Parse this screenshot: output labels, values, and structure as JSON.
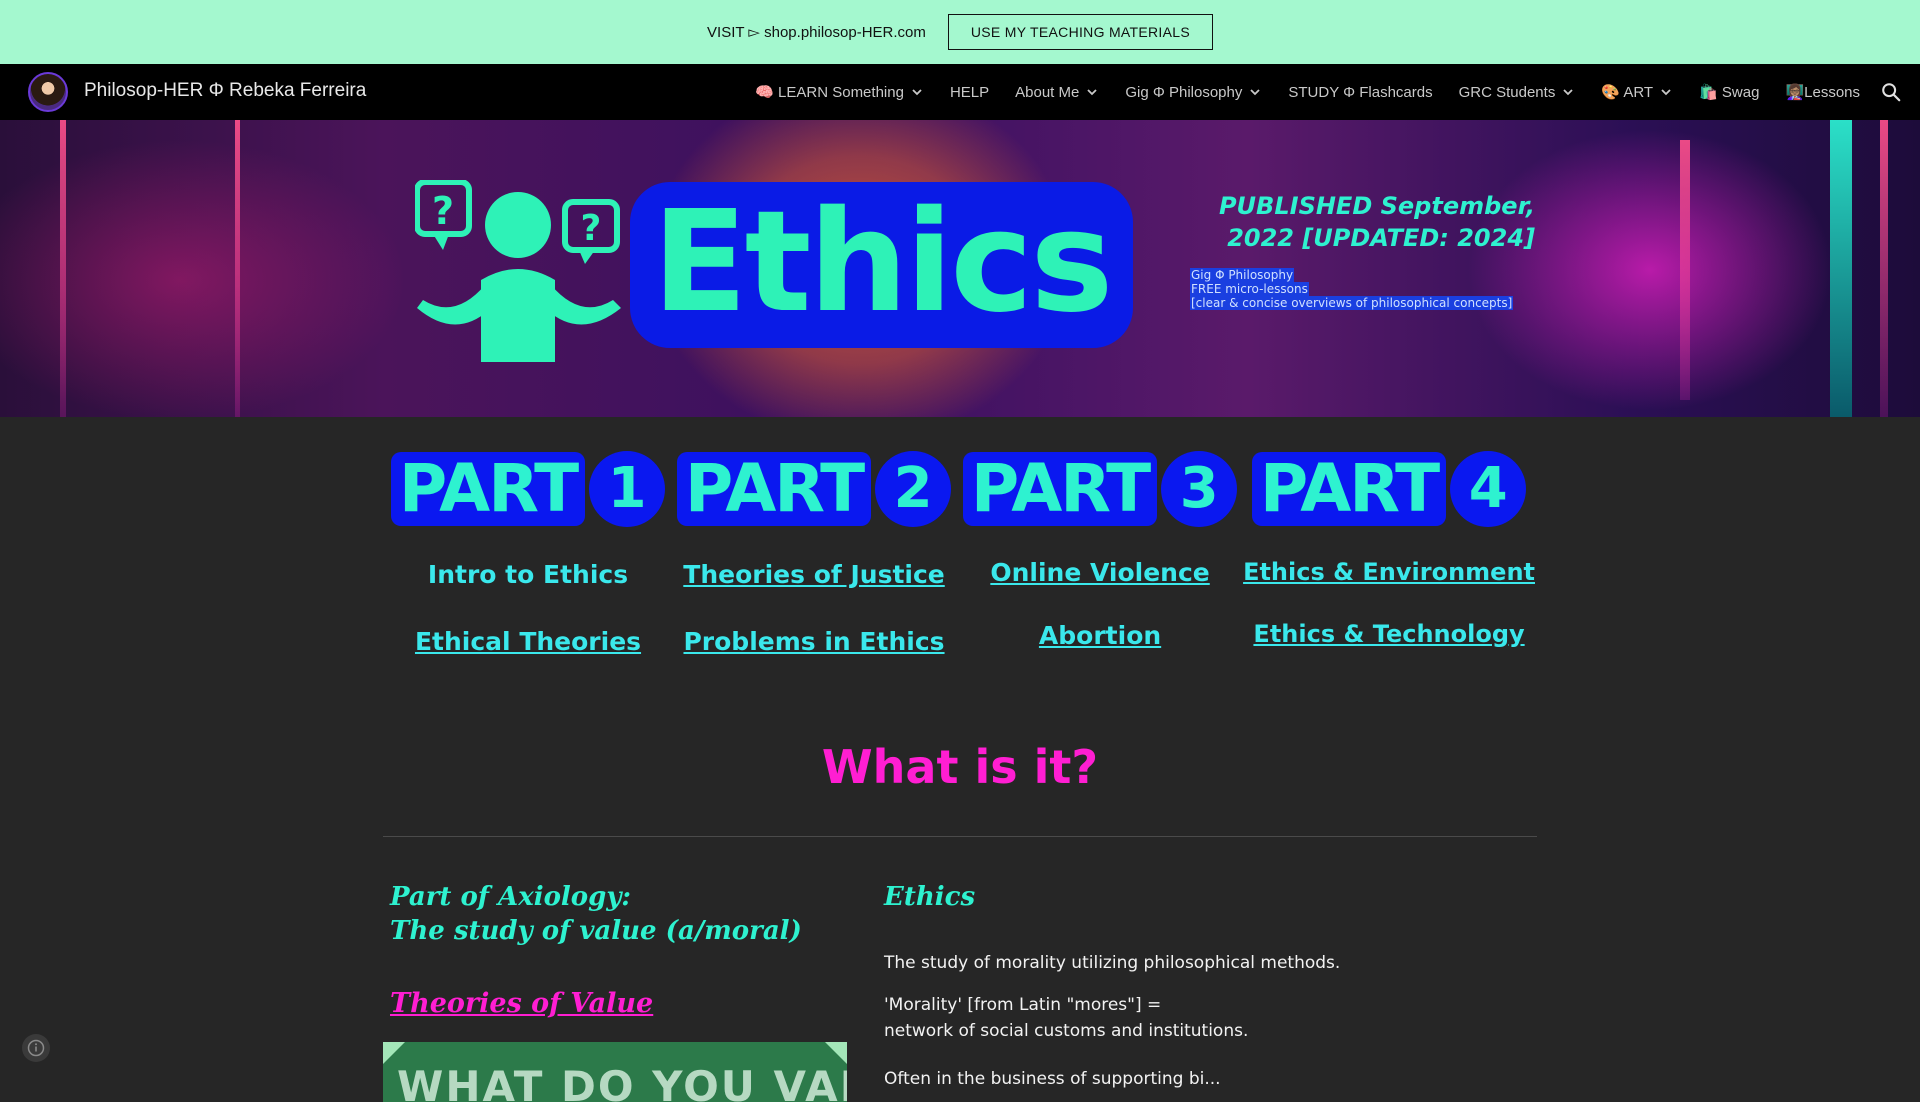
{
  "announcement": {
    "text": "VISIT ▻ shop.philosop-HER.com",
    "button": "USE MY TEACHING MATERIALS"
  },
  "nav": {
    "site_title": "Philosop-HER Φ Rebeka Ferreira",
    "items": [
      {
        "label": "🧠 LEARN Something",
        "dropdown": true
      },
      {
        "label": "HELP",
        "dropdown": false
      },
      {
        "label": "About Me",
        "dropdown": true
      },
      {
        "label": "Gig Φ Philosophy",
        "dropdown": true
      },
      {
        "label": "STUDY Φ Flashcards",
        "dropdown": false
      },
      {
        "label": "GRC Students",
        "dropdown": true
      },
      {
        "label": "🎨 ART",
        "dropdown": true
      },
      {
        "label": "🛍️ Swag",
        "dropdown": false
      },
      {
        "label": "👩🏽‍🏫Lessons",
        "dropdown": false
      }
    ],
    "search_icon": "search-icon"
  },
  "hero": {
    "word": "Ethics",
    "published_line1": "PUBLISHED September,",
    "published_line2": "2022 [UPDATED: 2024]",
    "sub1": "Gig Φ Philosophy",
    "sub2": "FREE micro-lessons",
    "sub3": "[clear & concise overviews of philosophical concepts]",
    "colors": {
      "accent": "#2ef2b7",
      "badge": "#0a1be6"
    }
  },
  "parts": [
    {
      "word": "PART",
      "num": "1",
      "link1": "Intro to Ethics",
      "link1_underlined": false,
      "link2": "Ethical Theories"
    },
    {
      "word": "PART",
      "num": "2",
      "link1": "Theories of Justice",
      "link1_underlined": true,
      "link2": "Problems in Ethics"
    },
    {
      "word": "PART",
      "num": "3",
      "link1": "Online Violence",
      "link1_underlined": true,
      "link2": "Abortion"
    },
    {
      "word": "PART",
      "num": "4",
      "link1": "Ethics & Environment",
      "link1_underlined": true,
      "link2": "Ethics & Technology"
    }
  ],
  "section": {
    "heading": "What is it?",
    "axiology_line1": "Part of Axiology:",
    "axiology_line2": "The study of value (a/moral)",
    "theories_of_value": "Theories of Value",
    "value_image_text": "WHAT DO YOU VALUE?",
    "ethics_title": "Ethics",
    "p1": "The study of morality utilizing philosophical methods.",
    "p2_line1": "'Morality' [from Latin \"mores\"] =",
    "p2_line2": "network of social customs and institutions.",
    "p3": "Often in the business of supporting bi..."
  },
  "footer": {
    "info_icon": "info-icon"
  }
}
